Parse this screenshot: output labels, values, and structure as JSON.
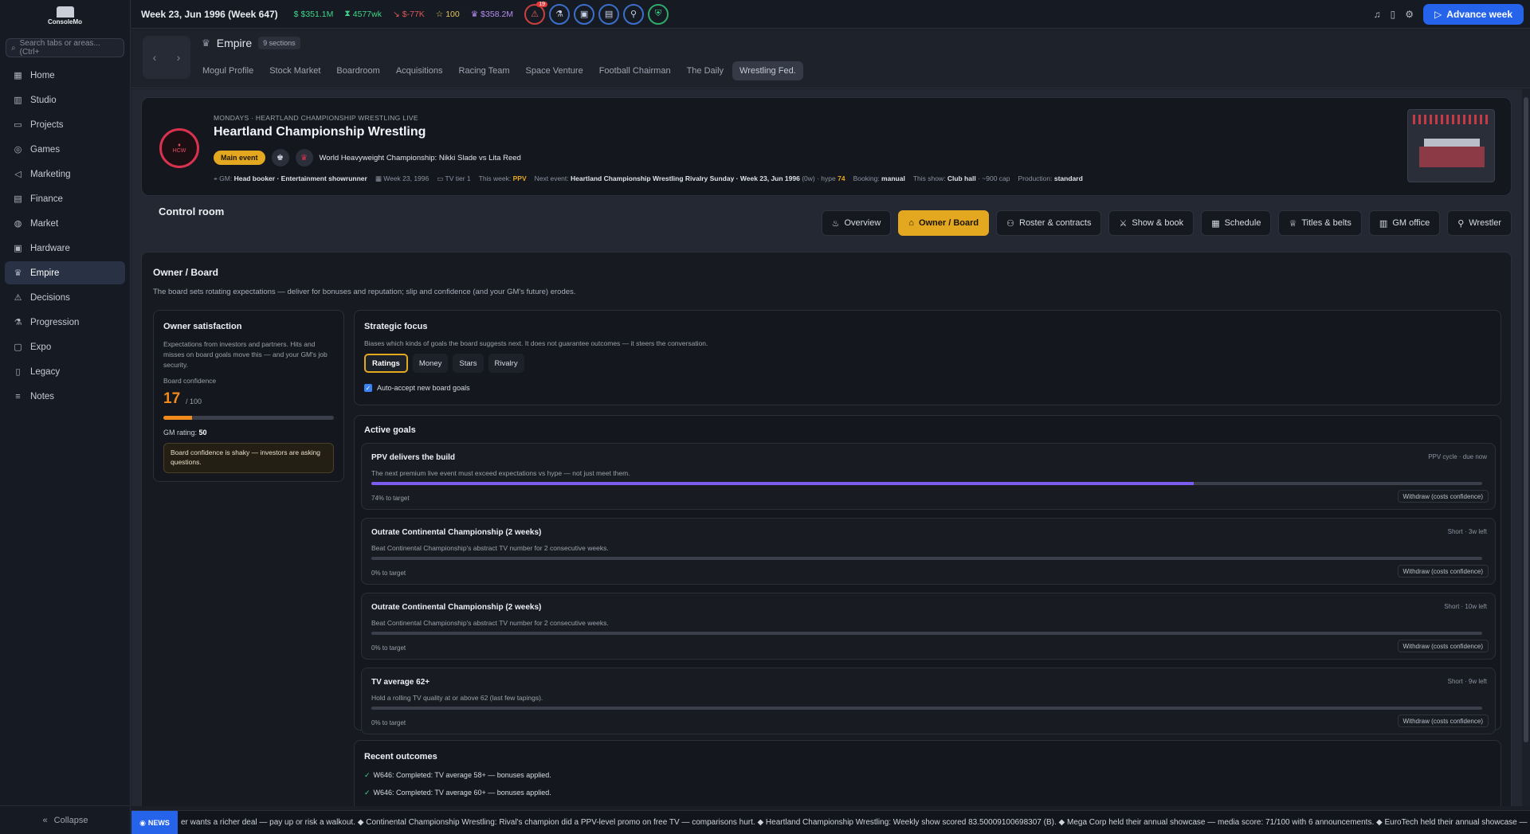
{
  "brand": {
    "logo_text": "ConsoleMo"
  },
  "sidebar": {
    "search_placeholder": "Search tabs or areas... (Ctrl+",
    "items": [
      {
        "label": "Home",
        "icon": "grid-icon"
      },
      {
        "label": "Studio",
        "icon": "building-icon"
      },
      {
        "label": "Projects",
        "icon": "folder-icon"
      },
      {
        "label": "Games",
        "icon": "gamepad-icon"
      },
      {
        "label": "Marketing",
        "icon": "megaphone-icon"
      },
      {
        "label": "Finance",
        "icon": "document-icon"
      },
      {
        "label": "Market",
        "icon": "globe-icon"
      },
      {
        "label": "Hardware",
        "icon": "chip-icon"
      },
      {
        "label": "Empire",
        "icon": "crown-icon",
        "active": true
      },
      {
        "label": "Decisions",
        "icon": "warning-icon"
      },
      {
        "label": "Progression",
        "icon": "flask-icon"
      },
      {
        "label": "Expo",
        "icon": "monitor-icon"
      },
      {
        "label": "Legacy",
        "icon": "book-icon"
      },
      {
        "label": "Notes",
        "icon": "notes-icon"
      }
    ],
    "collapse_label": "Collapse"
  },
  "topbar": {
    "week": "Week 23, Jun 1996 (Week 647)",
    "cash": "$351.1M",
    "weekly": "4577wk",
    "delta": "$-77K",
    "stars": "100",
    "valuation": "$358.2M",
    "alert_count": "19",
    "advance_label": "Advance week"
  },
  "section": {
    "title": "Empire",
    "count": "9 sections",
    "tabs": [
      "Mogul Profile",
      "Stock Market",
      "Boardroom",
      "Acquisitions",
      "Racing Team",
      "Space Venture",
      "Football Chairman",
      "The Daily",
      "Wrestling Fed."
    ]
  },
  "show": {
    "logo_text": "HCW",
    "kicker": "MONDAYS · HEARTLAND CHAMPIONSHIP WRESTLING LIVE",
    "name": "Heartland Championship Wrestling",
    "main_event_label": "Main event",
    "championship": "World Heavyweight Championship: Nikki Slade vs Lita Reed",
    "meta": {
      "gm_label": "GM:",
      "gm_value": "Head booker · Entertainment showrunner",
      "date": "Week 23, 1996",
      "tv_tier": "TV tier 1",
      "this_week_label": "This week:",
      "this_week_value": "PPV",
      "next_event_label": "Next event:",
      "next_event_value": "Heartland Championship Wrestling Rivalry Sunday · Week 23, Jun 1996",
      "next_event_suffix": "(0w) · hype",
      "hype": "74",
      "booking_label": "Booking:",
      "booking_value": "manual",
      "venue_label": "This show:",
      "venue_value": "Club hall",
      "venue_cap": "· ~900 cap",
      "production_label": "Production:",
      "production_value": "standard"
    }
  },
  "control_room": {
    "title": "Control room",
    "tabs": [
      {
        "label": "Overview",
        "icon": "flame-icon"
      },
      {
        "label": "Owner / Board",
        "icon": "bank-icon",
        "active": true
      },
      {
        "label": "Roster & contracts",
        "icon": "users-icon"
      },
      {
        "label": "Show & book",
        "icon": "swords-icon"
      },
      {
        "label": "Schedule",
        "icon": "calendar-icon"
      },
      {
        "label": "Titles & belts",
        "icon": "trophy-icon"
      },
      {
        "label": "GM office",
        "icon": "office-icon"
      },
      {
        "label": "Wrestler",
        "icon": "person-icon"
      }
    ]
  },
  "board": {
    "title": "Owner / Board",
    "description": "The board sets rotating expectations — deliver for bonuses and reputation; slip and confidence (and your GM's future) erodes.",
    "owner": {
      "title": "Owner satisfaction",
      "text": "Expectations from investors and partners. Hits and misses on board goals move this — and your GM's job security.",
      "confidence_label": "Board confidence",
      "confidence": "17",
      "confidence_max": "/ 100",
      "confidence_fraction": 0.17,
      "gm_rating_label": "GM rating:",
      "gm_rating": "50",
      "warning": "Board confidence is shaky — investors are asking questions."
    },
    "focus": {
      "title": "Strategic focus",
      "text": "Biases which kinds of goals the board suggests next. It does not guarantee outcomes — it steers the conversation.",
      "options": [
        "Ratings",
        "Money",
        "Stars",
        "Rivalry"
      ],
      "selected": "Ratings",
      "auto_accept_label": "Auto-accept new board goals",
      "auto_accept": true
    },
    "goals_title": "Active goals",
    "goals": [
      {
        "title": "PPV delivers the build",
        "desc": "The next premium live event must exceed expectations vs hype — not just meet them.",
        "meta": "PPV cycle · due now",
        "progress": 0.74,
        "progress_label": "74% to target",
        "withdraw": "Withdraw (costs confidence)"
      },
      {
        "title": "Outrate Continental Championship (2 weeks)",
        "desc": "Beat Continental Championship's abstract TV number for 2 consecutive weeks.",
        "meta": "Short · 3w left",
        "progress": 0,
        "progress_label": "0% to target",
        "withdraw": "Withdraw (costs confidence)"
      },
      {
        "title": "Outrate Continental Championship (2 weeks)",
        "desc": "Beat Continental Championship's abstract TV number for 2 consecutive weeks.",
        "meta": "Short · 10w left",
        "progress": 0,
        "progress_label": "0% to target",
        "withdraw": "Withdraw (costs confidence)"
      },
      {
        "title": "TV average 62+",
        "desc": "Hold a rolling TV quality at or above 62 (last few tapings).",
        "meta": "Short · 9w left",
        "progress": 0,
        "progress_label": "0% to target",
        "withdraw": "Withdraw (costs confidence)"
      }
    ],
    "outcomes_title": "Recent outcomes",
    "outcomes": [
      "W646: Completed: TV average 58+ — bonuses applied.",
      "W646: Completed: TV average 60+ — bonuses applied."
    ]
  },
  "news": {
    "tag": "NEWS",
    "text": "er wants a richer deal — pay up or risk a walkout. ◆ Continental Championship Wrestling: Rival's champion did a PPV-level promo on free TV — comparisons hurt. ◆ Heartland Championship Wrestling: Weekly show scored 83.50009100698307 (B). ◆ Mega Corp held their annual showcase — media score: 71/100 with 6 announcements. ◆ EuroTech held their annual showcase — media score:"
  },
  "colors": {
    "accent": "#e3a81f",
    "primary": "#2563eb",
    "confidence": "#f08a1c",
    "goal_bar": "#7c5cf0"
  }
}
